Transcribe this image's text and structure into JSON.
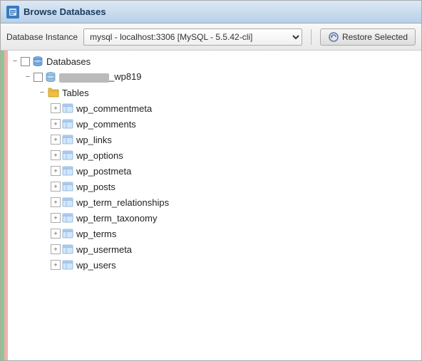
{
  "window": {
    "title": "Browse Databases"
  },
  "toolbar": {
    "instance_label": "Database Instance",
    "instance_value": "mysql - localhost:3306 [MySQL - 5.5.42-cli]",
    "instance_options": [
      "mysql - localhost:3306 [MySQL - 5.5.42-cli]"
    ],
    "restore_button_label": "Restore Selected"
  },
  "tree": {
    "root": {
      "label": "Databases",
      "expanded": true,
      "children": [
        {
          "label": "_wp819",
          "masked": true,
          "expanded": true,
          "children": [
            {
              "label": "Tables",
              "expanded": true,
              "children": [
                {
                  "label": "wp_commentmeta"
                },
                {
                  "label": "wp_comments"
                },
                {
                  "label": "wp_links"
                },
                {
                  "label": "wp_options"
                },
                {
                  "label": "wp_postmeta"
                },
                {
                  "label": "wp_posts"
                },
                {
                  "label": "wp_term_relationships"
                },
                {
                  "label": "wp_term_taxonomy"
                },
                {
                  "label": "wp_terms"
                },
                {
                  "label": "wp_usermeta"
                },
                {
                  "label": "wp_users"
                }
              ]
            }
          ]
        }
      ]
    }
  },
  "icons": {
    "database": "🗄",
    "table_folder": "📁",
    "table": "▦",
    "restore": "↺"
  }
}
